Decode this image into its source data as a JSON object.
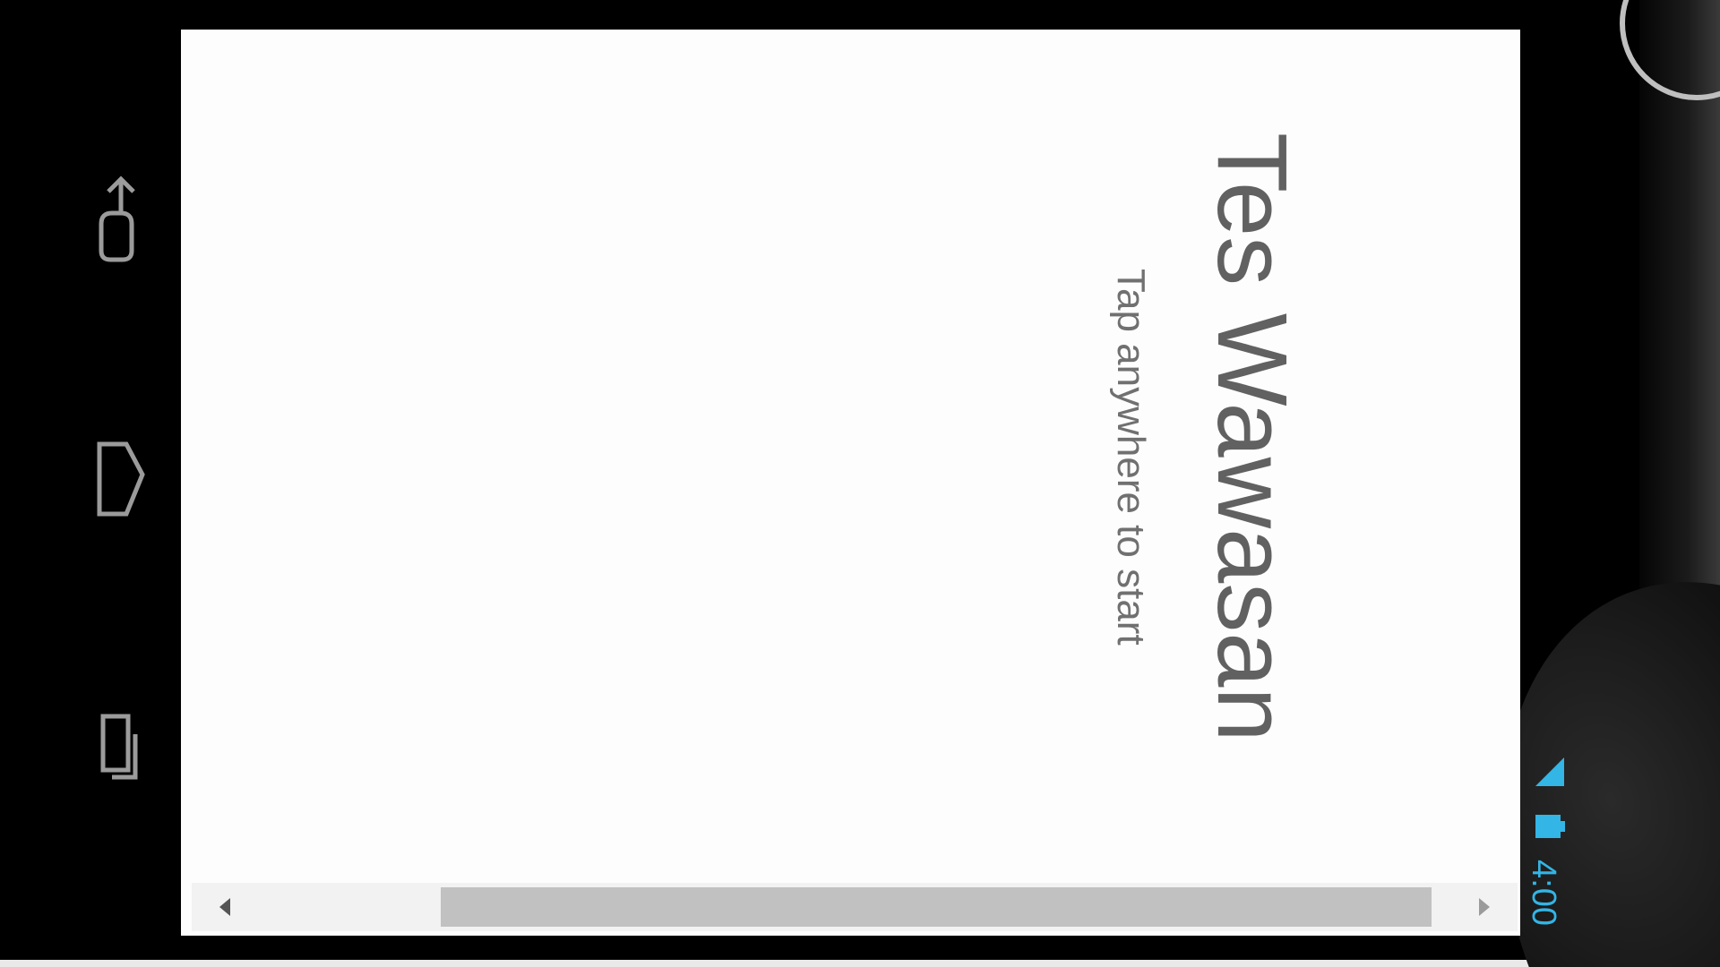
{
  "app": {
    "title": "Tes Wawasan",
    "subtitle": "Tap anywhere to start"
  },
  "nav_bar": {
    "buttons": [
      {
        "name": "back",
        "icon": "back-icon"
      },
      {
        "name": "home",
        "icon": "home-icon"
      },
      {
        "name": "recents",
        "icon": "recents-icon"
      }
    ]
  },
  "status_bar": {
    "time": "4:00",
    "icons": [
      "signal-icon",
      "battery-icon"
    ],
    "accent_color": "#33b5e5"
  },
  "scrollbar": {
    "position": 0.17,
    "visible_fraction": 0.79
  },
  "colors": {
    "screen_bg": "#fdfdfd",
    "title_text": "#616161",
    "subtitle_text": "#707070",
    "scroll_track": "#f2f2f2",
    "scroll_thumb": "#c1c1c1"
  }
}
